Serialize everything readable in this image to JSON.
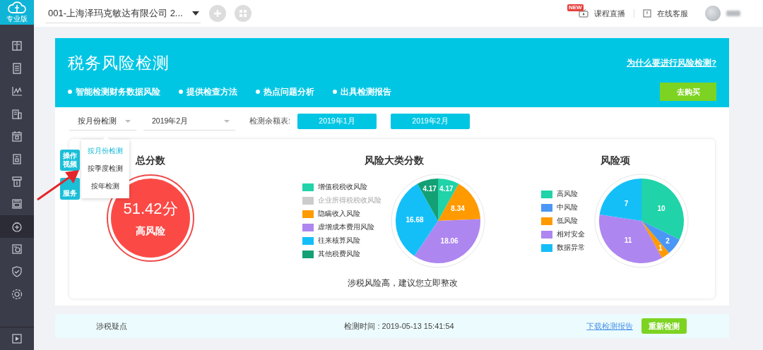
{
  "sidebar": {
    "logo_label": "专业版",
    "items": [
      {
        "selected": false
      },
      {
        "selected": false
      },
      {
        "selected": false
      },
      {
        "selected": false
      },
      {
        "selected": false
      },
      {
        "selected": false
      },
      {
        "selected": false
      },
      {
        "selected": false
      },
      {
        "selected": true
      },
      {
        "selected": false
      },
      {
        "selected": false
      },
      {
        "selected": false
      },
      {
        "selected": false
      }
    ]
  },
  "top_bar": {
    "company_select": "001-上海泽玛克敏达有限公司 2...",
    "new_badge": "NEW",
    "live_course": "课程直播",
    "online_service": "在线客服"
  },
  "banner": {
    "title": "税务风险检测",
    "link": "为什么要进行风险检测?",
    "features": [
      "智能检测财务数据风险",
      "提供检查方法",
      "热点问题分析",
      "出具检测报告"
    ],
    "buy_button": "去购买"
  },
  "filters": {
    "mode_select": "按月份检测",
    "month_select": "2019年2月",
    "balance_label": "检测余额表:",
    "balance_buttons": [
      "2019年1月",
      "2019年2月"
    ],
    "mode_menu": [
      {
        "label": "按月份检测",
        "selected": true
      },
      {
        "label": "按季度检测",
        "selected": false
      },
      {
        "label": "按年检测",
        "selected": false
      }
    ]
  },
  "side_badges": [
    "操作视频",
    "服务"
  ],
  "score": {
    "title": "总分数",
    "value": "51.42分",
    "level_label": "高风险"
  },
  "category_chart": {
    "legend": [
      {
        "color": "#20d3a8",
        "disabled": false
      },
      {
        "disabled": true
      },
      {
        "color": "#ff9a00",
        "disabled": false
      },
      {
        "color": "#ae86f0",
        "disabled": false
      },
      {
        "color": "#14bff8",
        "disabled": false
      },
      {
        "color": "#13a074",
        "disabled": false
      }
    ],
    "chart_data": {
      "type": "pie",
      "title": "风险大类分数",
      "categories": [
        "增值税税收风险",
        "企业所得税税收风险",
        "隐瞒收入风险",
        "虚增成本费用风险",
        "往来核算风险",
        "其他税费风险"
      ],
      "values": [
        4.17,
        null,
        8.34,
        18.06,
        16.68,
        4.17
      ],
      "data_labels": true
    }
  },
  "item_chart": {
    "legend": [
      {
        "color": "#20d3a8",
        "disabled": false
      },
      {
        "color": "#4a97f5",
        "disabled": false
      },
      {
        "color": "#ff9a00",
        "disabled": false
      },
      {
        "color": "#ae86f0",
        "disabled": false
      },
      {
        "color": "#14bff8",
        "disabled": false
      }
    ],
    "chart_data": {
      "type": "pie",
      "title": "风险项",
      "categories": [
        "高风险",
        "中风险",
        "低风险",
        "相对安全",
        "数据异常"
      ],
      "values": [
        10,
        2,
        1,
        11,
        7
      ],
      "data_labels": true
    }
  },
  "advice": "涉税风险高，建议您立即整改",
  "bottom_bar": {
    "label": "涉税疑点",
    "time": "检测时间 : 2019-05-13 15:41:54",
    "download_link": "下载检测报告",
    "recheck_button": "重新检测"
  }
}
